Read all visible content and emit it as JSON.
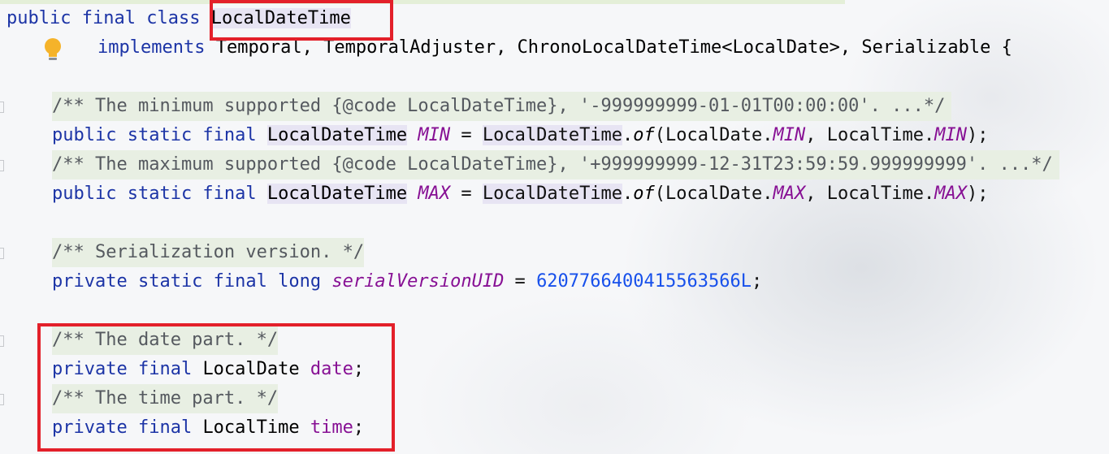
{
  "editor": {
    "line1": {
      "public": "public",
      "final": "final",
      "class": "class",
      "classname": "LocalDateTime"
    },
    "line2": {
      "implements": "implements",
      "rest": "Temporal, TemporalAdjuster, ChronoLocalDateTime<LocalDate>, Serializable {"
    },
    "comment_min": "/** The minimum supported {@code LocalDateTime}, '-999999999-01-01T00:00:00'. ...*/",
    "min_decl": {
      "mods": "public static final",
      "type": "LocalDateTime",
      "name": "MIN",
      "eq": " = ",
      "call_class": "LocalDateTime",
      "dot": ".",
      "method": "of",
      "arg1_class": "LocalDate",
      "arg1_field": "MIN",
      "arg2_class": "LocalTime",
      "arg2_field": "MIN",
      "end": ");"
    },
    "comment_max": "/** The maximum supported {@code LocalDateTime}, '+999999999-12-31T23:59:59.999999999'. ...*/",
    "max_decl": {
      "mods": "public static final",
      "type": "LocalDateTime",
      "name": "MAX",
      "eq": " = ",
      "call_class": "LocalDateTime",
      "dot": ".",
      "method": "of",
      "arg1_class": "LocalDate",
      "arg1_field": "MAX",
      "arg2_class": "LocalTime",
      "arg2_field": "MAX",
      "end": ");"
    },
    "comment_serial": "/** Serialization version. */",
    "serial_decl": {
      "mods": "private static final long",
      "name": "serialVersionUID",
      "eq": " = ",
      "value": "6207766400415563566L",
      "end": ";"
    },
    "comment_date": "/** The date part. */",
    "date_decl": {
      "mods": "private final",
      "type": "LocalDate",
      "name": "date",
      "end": ";"
    },
    "comment_time": "/** The time part. */",
    "time_decl": {
      "mods": "private final",
      "type": "LocalTime",
      "name": "time",
      "end": ";"
    }
  },
  "colors": {
    "keyword": "#1c34a6",
    "field": "#871094",
    "number": "#1750eb",
    "highlight_box": "#e3202a",
    "comment_bg": "#e8efe3"
  },
  "icons": {
    "intention": "lightbulb-icon"
  }
}
